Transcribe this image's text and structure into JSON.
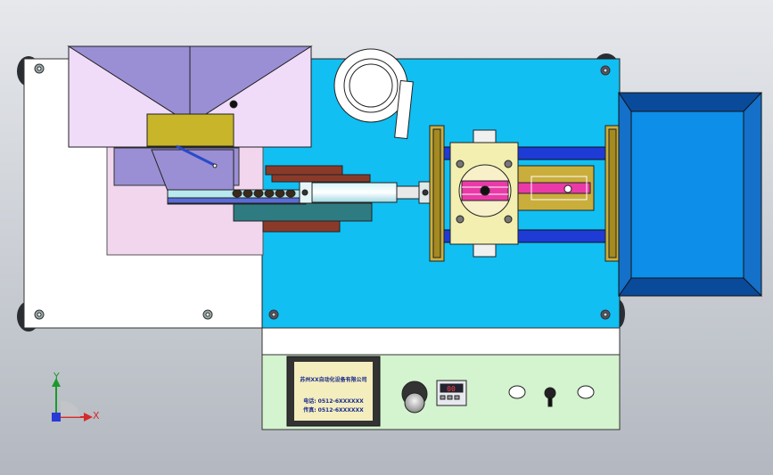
{
  "viewport": {
    "background_top": "#e6e8ec",
    "background_bottom": "#b3b8c0"
  },
  "colors": {
    "base_plate": "#ffffff",
    "table_top": "#11bff2",
    "hopper_front": "#f0dcf8",
    "hopper_sides": "#9a8fd4",
    "hopper_throat": "#c8b52a",
    "chute": "#9a8fd4",
    "pink_plate": "#f1d6ee",
    "feed_rail": "#b8e8f0",
    "rod": "#1e3bd6",
    "carriage": "#f3efb0",
    "bracket": "#c9ae3c",
    "bin_rim": "#1470c8",
    "bin_inner": "#0d8ee8",
    "control_panel": "#d4f3cf",
    "nameplate": "#f4eebe",
    "magenta": "#ea3aa8",
    "reel": "#ffffff"
  },
  "nameplate": {
    "line1": "苏州XX自动化设备有限公司",
    "line2": "电话: 0512-6XXXXXX",
    "line3": "传真: 0512-6XXXXXX"
  },
  "controls": {
    "display_value": "00"
  },
  "axes": {
    "y": "Y",
    "x": "X"
  }
}
